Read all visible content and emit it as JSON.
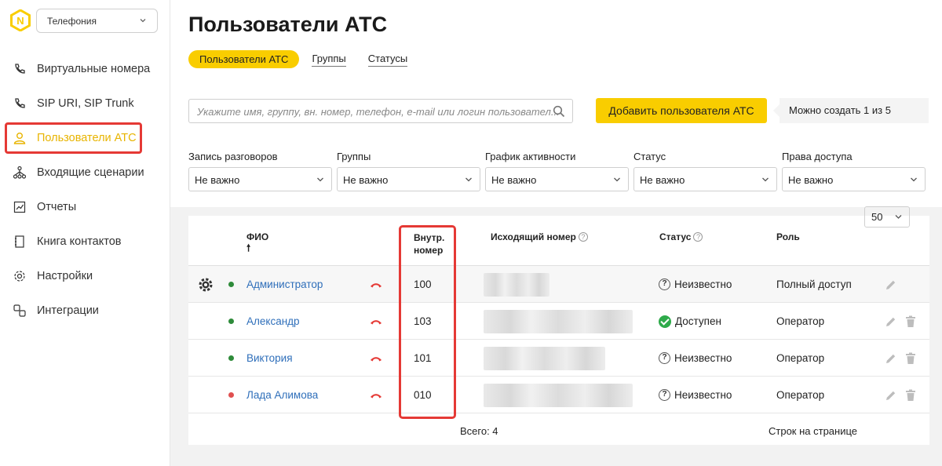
{
  "sidebar": {
    "product": "Телефония",
    "items": [
      {
        "label": "Виртуальные номера",
        "icon": "phone-icon"
      },
      {
        "label": "SIP URI, SIP Trunk",
        "icon": "phone-icon"
      },
      {
        "label": "Пользователи АТС",
        "icon": "user-icon",
        "active": true
      },
      {
        "label": "Входящие сценарии",
        "icon": "flow-icon"
      },
      {
        "label": "Отчеты",
        "icon": "report-icon"
      },
      {
        "label": "Книга контактов",
        "icon": "contacts-icon"
      },
      {
        "label": "Настройки",
        "icon": "gear-icon"
      },
      {
        "label": "Интеграции",
        "icon": "integration-icon"
      }
    ]
  },
  "header": {
    "title": "Пользователи АТС",
    "tabs": [
      "Пользователи АТС",
      "Группы",
      "Статусы"
    ]
  },
  "search": {
    "placeholder": "Укажите имя, группу, вн. номер, телефон, e-mail или логин пользовател..."
  },
  "actions": {
    "add_user": "Добавить пользователя АТС",
    "limit": "Можно создать 1 из 5"
  },
  "filters": [
    {
      "label": "Запись разговоров",
      "value": "Не важно"
    },
    {
      "label": "Группы",
      "value": "Не важно"
    },
    {
      "label": "График активности",
      "value": "Не важно"
    },
    {
      "label": "Статус",
      "value": "Не важно"
    },
    {
      "label": "Права доступа",
      "value": "Не важно"
    }
  ],
  "table": {
    "headers": {
      "name": "ФИО",
      "sort_arrow": "🠕",
      "ext_line1": "Внутр.",
      "ext_line2": "номер",
      "outgoing": "Исходящий номер",
      "status": "Статус",
      "role": "Роль",
      "help": "?"
    },
    "rows": [
      {
        "name": "Администратор",
        "dot_color": "#2e8b3a",
        "ext": "100",
        "status": "Неизвестно",
        "status_type": "unknown",
        "role": "Полный доступ",
        "deletable": false,
        "settings": true,
        "blur_width": 84
      },
      {
        "name": "Александр",
        "dot_color": "#2e8b3a",
        "ext": "103",
        "status": "Доступен",
        "status_type": "ok",
        "role": "Оператор",
        "deletable": true,
        "settings": false,
        "blur_width": 190
      },
      {
        "name": "Виктория",
        "dot_color": "#2e8b3a",
        "ext": "101",
        "status": "Неизвестно",
        "status_type": "unknown",
        "role": "Оператор",
        "deletable": true,
        "settings": false,
        "blur_width": 155
      },
      {
        "name": "Лада Алимова",
        "dot_color": "#e05050",
        "ext": "010",
        "status": "Неизвестно",
        "status_type": "unknown",
        "role": "Оператор",
        "deletable": true,
        "settings": false,
        "blur_width": 190
      }
    ],
    "total": "Всего: 4",
    "per_page_label": "Строк на странице",
    "per_page_value": "50"
  },
  "colors": {
    "accent": "#f9cd00",
    "highlight": "#e53935",
    "link": "#2f6fba",
    "hangup": "#e53935"
  }
}
